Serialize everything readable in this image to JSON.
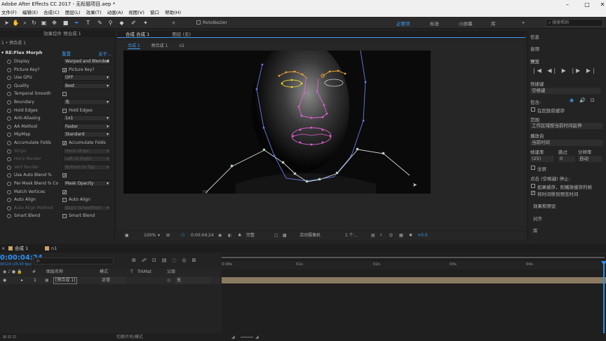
{
  "window": {
    "title": "Adobe After Effects CC 2017 - 无标题项目.aep *"
  },
  "menu": [
    "文件(F)",
    "编辑(E)",
    "合成(C)",
    "图层(L)",
    "效果(T)",
    "动画(A)",
    "视图(V)",
    "窗口",
    "帮助(H)"
  ],
  "toolbar": {
    "rotobezier_label": "RotoBezier",
    "workspaces": [
      "必要项",
      "标准",
      "小屏幕",
      "库"
    ],
    "active_workspace": "必要项",
    "search_placeholder": "搜索帮助"
  },
  "effects_panel": {
    "tab_label": "效果控件 预合成 1",
    "breadcrumb": "1 • 预合成 1",
    "effect_name": "RE:Flex Morph",
    "reset_label": "重置",
    "about_label": "关于...",
    "rows": [
      {
        "label": "Display",
        "value": "Warped and Blended"
      },
      {
        "label": "Picture Key?",
        "check_label": "Picture Key?",
        "checked": true
      },
      {
        "label": "Use GPU",
        "value": "OFF"
      },
      {
        "label": "Quality",
        "value": "Best"
      },
      {
        "label": "Temporal Smooth",
        "checked": false
      },
      {
        "label": "Boundary",
        "value": "无"
      },
      {
        "label": "Hold Edges",
        "check_label": "Hold Edges",
        "checked": false
      },
      {
        "label": "Anti-Aliasing",
        "value": "1x1"
      },
      {
        "label": "AA Method",
        "value": "Faster"
      },
      {
        "label": "MipMap",
        "value": "Standard"
      },
      {
        "label": "Accumulate Folds",
        "check_label": "Accumulate Folds",
        "checked": true
      },
      {
        "label": "Strips",
        "value": "Horiz strips",
        "dim": true
      },
      {
        "label": "Horiz Render",
        "value": "Left to Right",
        "dim": true
      },
      {
        "label": "Vert Render",
        "value": "Bottom to Top",
        "dim": true
      },
      {
        "label": "Use Auto Blend %",
        "checked": true
      },
      {
        "label": "Per-Mask Blend % Co",
        "value": "Mask Opacity"
      },
      {
        "label": "Match Vertices",
        "checked": true
      },
      {
        "label": "Auto Align",
        "check_label": "Auto Align",
        "checked": false
      },
      {
        "label": "Auto Align Method",
        "value": "Basic (smoother)",
        "dim": true
      },
      {
        "label": "Smart Blend",
        "check_label": "Smart Blend",
        "checked": false
      }
    ]
  },
  "composition": {
    "tab_label": "合成 合成 1",
    "layer_tab_label": "图层 (无)",
    "sub_tabs": [
      "合成 1",
      "预合成 1",
      "n1"
    ],
    "zoom": "100%",
    "timecode": "0:00:04:24",
    "resolution": "完整",
    "camera": "活动摄像机",
    "views": "1 个...",
    "exposure": "+0.0"
  },
  "right_panel": {
    "info": "信息",
    "audio": "音频",
    "preview": "预览",
    "shortcut_label": "快捷键",
    "shortcut_value": "空格键",
    "include_label": "包含:",
    "cache_label": "在回放前缓存",
    "range_label": "范围",
    "range_value": "工作区域按当前时间延伸",
    "play_from_label": "播放自",
    "play_from_value": "当前时间",
    "fps_label": "帧速率",
    "skip_label": "跳过",
    "resolution_label": "分辨率",
    "fps_value": "(25)",
    "skip_value": "0",
    "resolution_value": "自动",
    "fullscreen_label": "全屏",
    "stop_label": "点击 (空格键) 停止:",
    "if_cache_label": "如果缓存，则播放缓存的帧",
    "move_time_label": "将时间移到预览时间",
    "effects_presets": "效果和预设",
    "align": "对齐",
    "library": "库"
  },
  "timeline": {
    "tabs": [
      "合成 1",
      "n1"
    ],
    "timecode": "0:00:04:24",
    "fps_note": "00124 (25.00 fps)",
    "search_placeholder": "ρ.",
    "columns": [
      "#",
      "图层名称",
      "模式",
      "T",
      "TrkMat",
      "父级"
    ],
    "layers": [
      {
        "index": "1",
        "name": "[预合成 1]",
        "mode": "正常",
        "parent": "无"
      }
    ],
    "ruler_labels": [
      "0:00s",
      "01s",
      "02s",
      "03s",
      "04s"
    ],
    "bottom_label": "切换开关/模式"
  },
  "colors": {
    "accent": "#2f8ff0",
    "track": "#8b7a62",
    "mask_pink": "#e060d0",
    "mask_orange": "#f0a030",
    "mask_yellow": "#e8d030",
    "mask_blue": "#6a7be0",
    "mask_white": "#d0d8d0"
  }
}
